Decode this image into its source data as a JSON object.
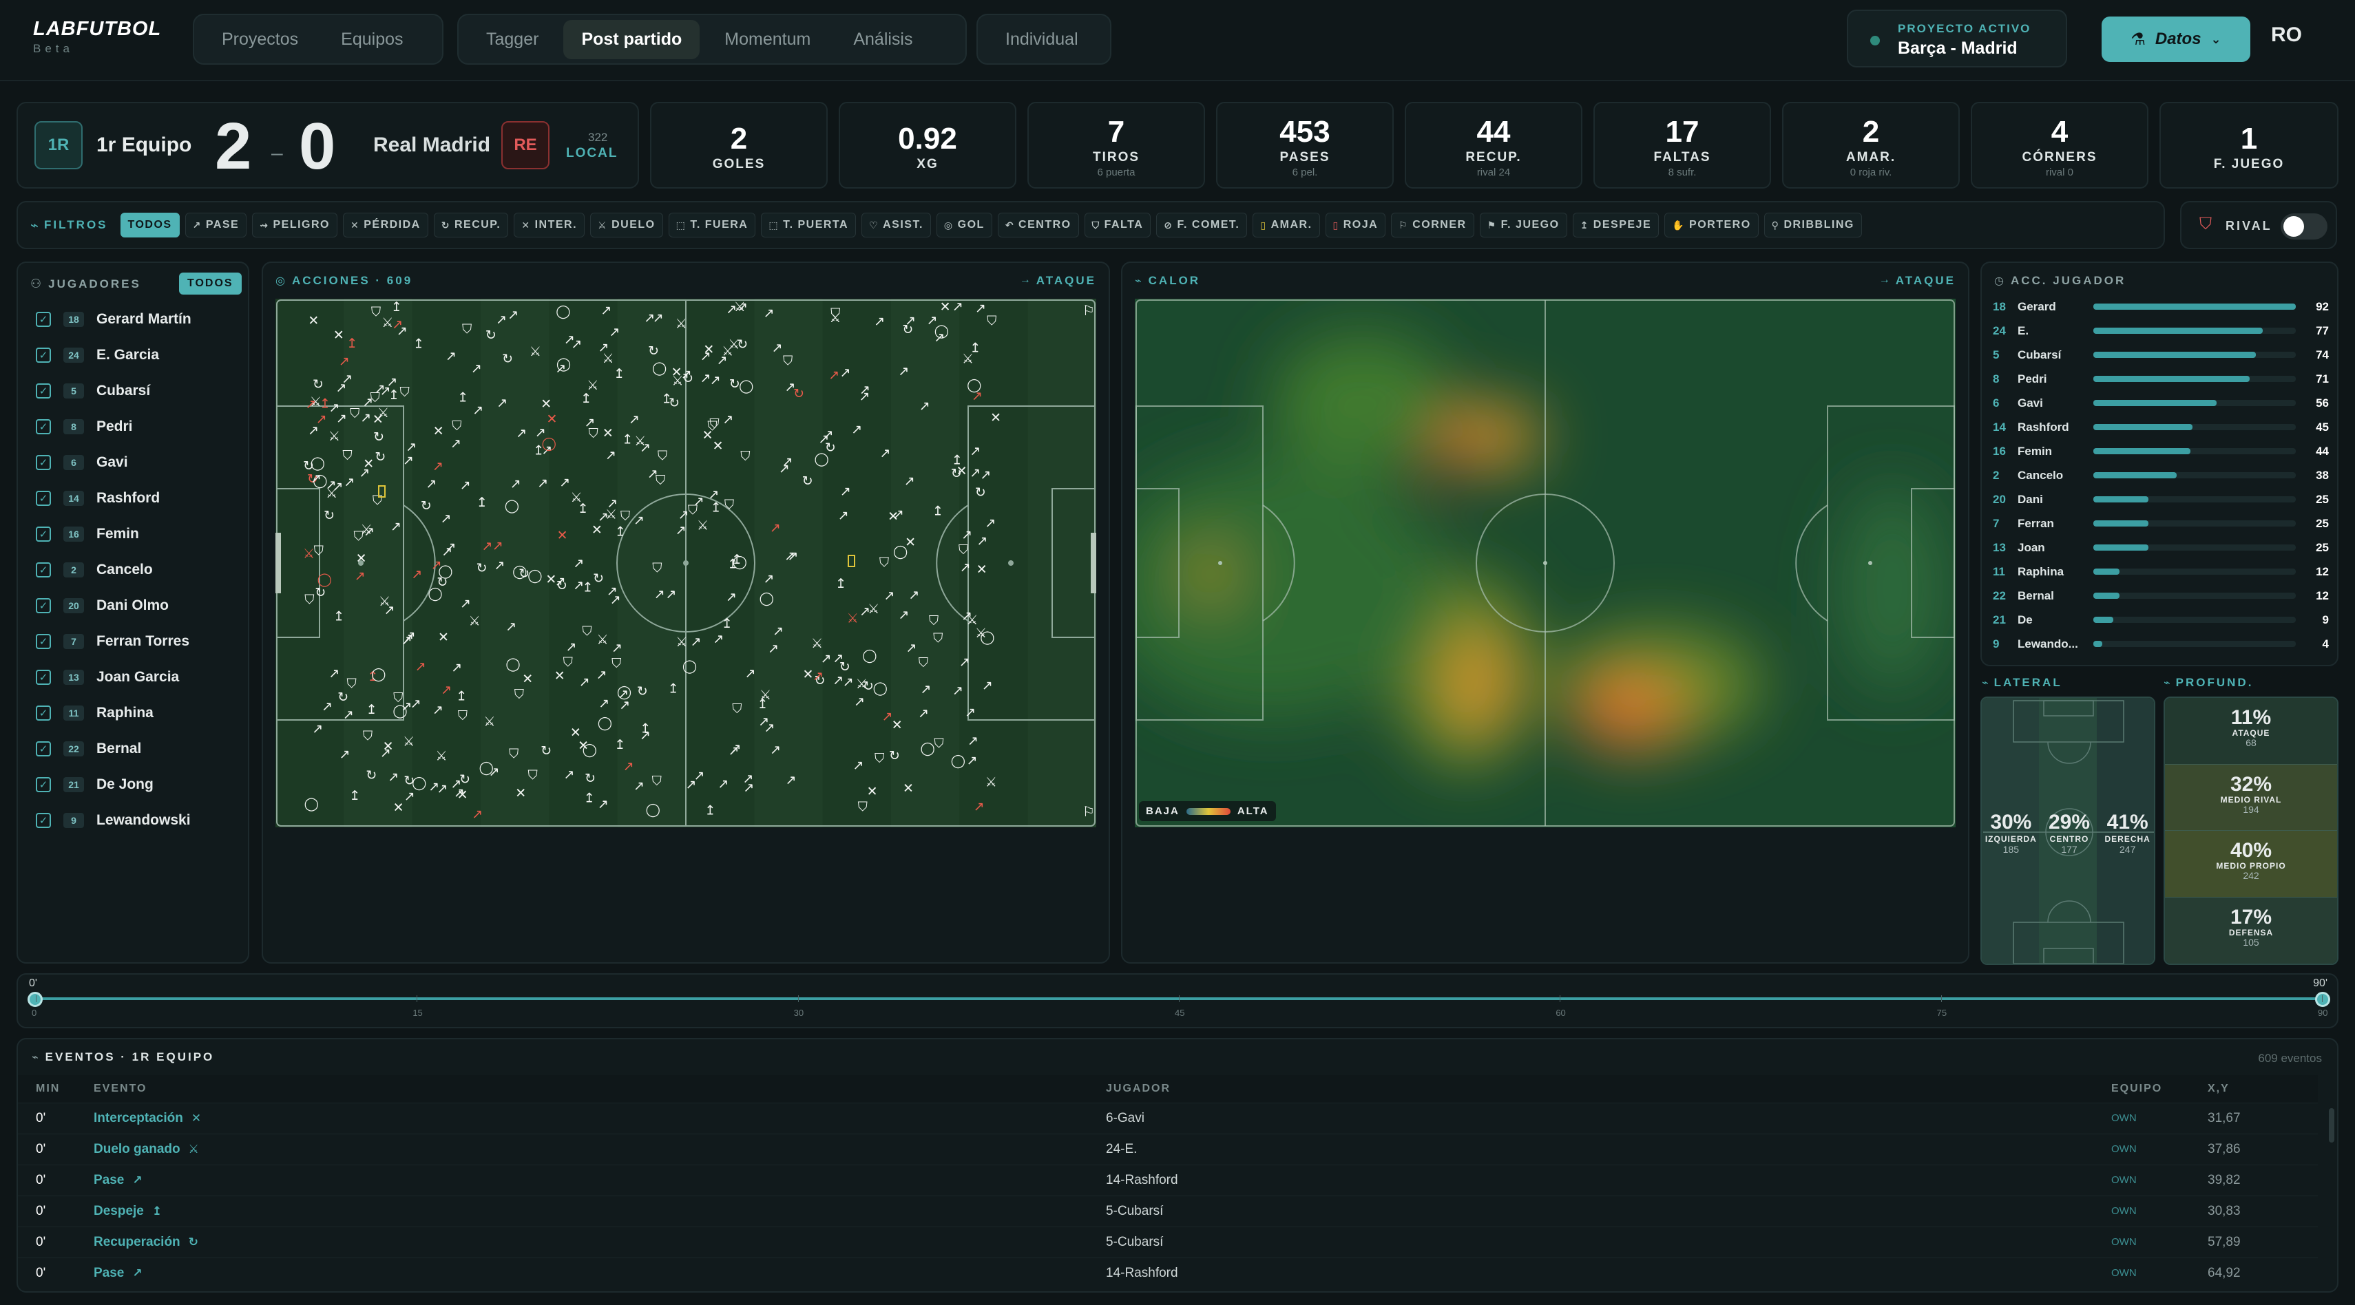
{
  "brand": {
    "name": "LABFUTBOL",
    "sub": "Beta"
  },
  "nav": {
    "groups": [
      [
        "Proyectos",
        "Equipos"
      ],
      [
        "Tagger",
        "Post partido",
        "Momentum",
        "Análisis"
      ],
      [
        "Individual"
      ]
    ],
    "active": "Post partido"
  },
  "project": {
    "label": "PROYECTO ACTIVO",
    "name": "Barça - Madrid"
  },
  "datos_button": "Datos",
  "user_initials": "RO",
  "score": {
    "home_badge": "1R",
    "home": "1r Equipo",
    "home_goals": "2",
    "sep": "–",
    "away_goals": "0",
    "away": "Real Madrid",
    "away_badge": "RE",
    "match_num": "322",
    "match_loc": "LOCAL"
  },
  "kpis": [
    {
      "v": "2",
      "l": "GOLES",
      "s": ""
    },
    {
      "v": "0.92",
      "l": "XG",
      "s": ""
    },
    {
      "v": "7",
      "l": "TIROS",
      "s": "6 puerta"
    },
    {
      "v": "453",
      "l": "PASES",
      "s": "6 pel."
    },
    {
      "v": "44",
      "l": "RECUP.",
      "s": "rival 24"
    },
    {
      "v": "17",
      "l": "FALTAS",
      "s": "8 sufr."
    },
    {
      "v": "2",
      "l": "AMAR.",
      "s": "0 roja riv."
    },
    {
      "v": "4",
      "l": "CÓRNERS",
      "s": "rival 0"
    },
    {
      "v": "1",
      "l": "F. JUEGO",
      "s": ""
    }
  ],
  "filters": {
    "label": "FILTROS",
    "chips": [
      "TODOS",
      "PASE",
      "PELIGRO",
      "PÉRDIDA",
      "RECUP.",
      "INTER.",
      "DUELO",
      "T. FUERA",
      "T. PUERTA",
      "ASIST.",
      "GOL",
      "CENTRO",
      "FALTA",
      "F. COMET.",
      "AMAR.",
      "ROJA",
      "CORNER",
      "F. JUEGO",
      "DESPEJE",
      "PORTERO",
      "DRIBBLING"
    ],
    "rival_label": "RIVAL"
  },
  "players_panel": {
    "title": "JUGADORES",
    "badge": "TODOS",
    "players": [
      {
        "n": "18",
        "name": "Gerard Martín"
      },
      {
        "n": "24",
        "name": "E. Garcia"
      },
      {
        "n": "5",
        "name": "Cubarsí"
      },
      {
        "n": "8",
        "name": "Pedri"
      },
      {
        "n": "6",
        "name": "Gavi"
      },
      {
        "n": "14",
        "name": "Rashford"
      },
      {
        "n": "16",
        "name": "Femin"
      },
      {
        "n": "2",
        "name": "Cancelo"
      },
      {
        "n": "20",
        "name": "Dani Olmo"
      },
      {
        "n": "7",
        "name": "Ferran Torres"
      },
      {
        "n": "13",
        "name": "Joan Garcia"
      },
      {
        "n": "11",
        "name": "Raphina"
      },
      {
        "n": "22",
        "name": "Bernal"
      },
      {
        "n": "21",
        "name": "De Jong"
      },
      {
        "n": "9",
        "name": "Lewandowski"
      }
    ]
  },
  "actions_panel": {
    "title": "ACCIONES · 609",
    "dir": "ATAQUE"
  },
  "heat_panel": {
    "title": "CALOR",
    "dir": "ATAQUE",
    "low": "BAJA",
    "high": "ALTA"
  },
  "acc_panel": {
    "title": "ACC. JUGADOR",
    "rows": [
      {
        "n": "18",
        "name": "Gerard",
        "v": 92
      },
      {
        "n": "24",
        "name": "E.",
        "v": 77
      },
      {
        "n": "5",
        "name": "Cubarsí",
        "v": 74
      },
      {
        "n": "8",
        "name": "Pedri",
        "v": 71
      },
      {
        "n": "6",
        "name": "Gavi",
        "v": 56
      },
      {
        "n": "14",
        "name": "Rashford",
        "v": 45
      },
      {
        "n": "16",
        "name": "Femin",
        "v": 44
      },
      {
        "n": "2",
        "name": "Cancelo",
        "v": 38
      },
      {
        "n": "20",
        "name": "Dani",
        "v": 25
      },
      {
        "n": "7",
        "name": "Ferran",
        "v": 25
      },
      {
        "n": "13",
        "name": "Joan",
        "v": 25
      },
      {
        "n": "11",
        "name": "Raphina",
        "v": 12
      },
      {
        "n": "22",
        "name": "Bernal",
        "v": 12
      },
      {
        "n": "21",
        "name": "De",
        "v": 9
      },
      {
        "n": "9",
        "name": "Lewando...",
        "v": 4
      }
    ]
  },
  "lateral": {
    "title": "LATERAL",
    "zones": [
      {
        "p": "30%",
        "l": "IZQUIERDA",
        "c": "185"
      },
      {
        "p": "29%",
        "l": "CENTRO",
        "c": "177"
      },
      {
        "p": "41%",
        "l": "DERECHA",
        "c": "247"
      }
    ]
  },
  "profund": {
    "title": "PROFUND.",
    "zones": [
      {
        "p": "11%",
        "l": "ATAQUE",
        "c": "68"
      },
      {
        "p": "32%",
        "l": "MEDIO RIVAL",
        "c": "194"
      },
      {
        "p": "40%",
        "l": "MEDIO PROPIO",
        "c": "242"
      },
      {
        "p": "17%",
        "l": "DEFENSA",
        "c": "105"
      }
    ]
  },
  "timeline": {
    "start": "0'",
    "end": "90'",
    "ticks": [
      "0",
      "15",
      "30",
      "45",
      "60",
      "75",
      "90"
    ]
  },
  "events": {
    "title": "EVENTOS · 1R EQUIPO",
    "count": "609 eventos",
    "cols": [
      "MIN",
      "EVENTO",
      "JUGADOR",
      "EQUIPO",
      "X,Y"
    ],
    "rows": [
      {
        "min": "0'",
        "ev": "Interceptación",
        "icon": "✕",
        "pl": "6-Gavi",
        "team": "OWN",
        "xy": "31,67"
      },
      {
        "min": "0'",
        "ev": "Duelo ganado",
        "icon": "⚔",
        "pl": "24-E.",
        "team": "OWN",
        "xy": "37,86"
      },
      {
        "min": "0'",
        "ev": "Pase",
        "icon": "↗",
        "pl": "14-Rashford",
        "team": "OWN",
        "xy": "39,82"
      },
      {
        "min": "0'",
        "ev": "Despeje",
        "icon": "↥",
        "pl": "5-Cubarsí",
        "team": "OWN",
        "xy": "30,83"
      },
      {
        "min": "0'",
        "ev": "Recuperación",
        "icon": "↻",
        "pl": "5-Cubarsí",
        "team": "OWN",
        "xy": "57,89"
      },
      {
        "min": "0'",
        "ev": "Pase",
        "icon": "↗",
        "pl": "14-Rashford",
        "team": "OWN",
        "xy": "64,92"
      }
    ]
  }
}
